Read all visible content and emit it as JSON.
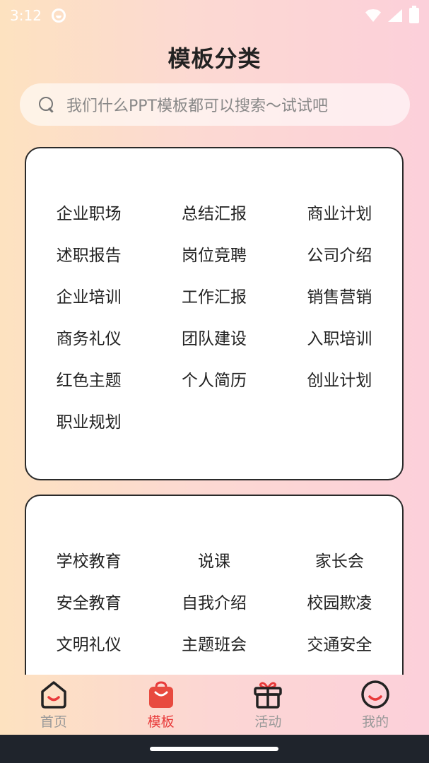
{
  "status_bar": {
    "time": "3:12"
  },
  "page": {
    "title": "模板分类"
  },
  "search": {
    "placeholder": "我们什么PPT模板都可以搜索～试试吧"
  },
  "categories_group1": [
    "企业职场",
    "总结汇报",
    "商业计划",
    "述职报告",
    "岗位竞聘",
    "公司介绍",
    "企业培训",
    "工作汇报",
    "销售营销",
    "商务礼仪",
    "团队建设",
    "入职培训",
    "红色主题",
    "个人简历",
    "创业计划",
    "职业规划"
  ],
  "categories_group2": [
    "学校教育",
    "说课",
    "家长会",
    "安全教育",
    "自我介绍",
    "校园欺凌",
    "文明礼仪",
    "主题班会",
    "交通安全"
  ],
  "tabs": [
    {
      "label": "首页",
      "icon": "home-icon",
      "active": false
    },
    {
      "label": "模板",
      "icon": "shopping-bag-icon",
      "active": true
    },
    {
      "label": "活动",
      "icon": "gift-icon",
      "active": false
    },
    {
      "label": "我的",
      "icon": "profile-icon",
      "active": false
    }
  ],
  "colors": {
    "accent": "#e83a3a",
    "inactive_tab": "#999999"
  }
}
